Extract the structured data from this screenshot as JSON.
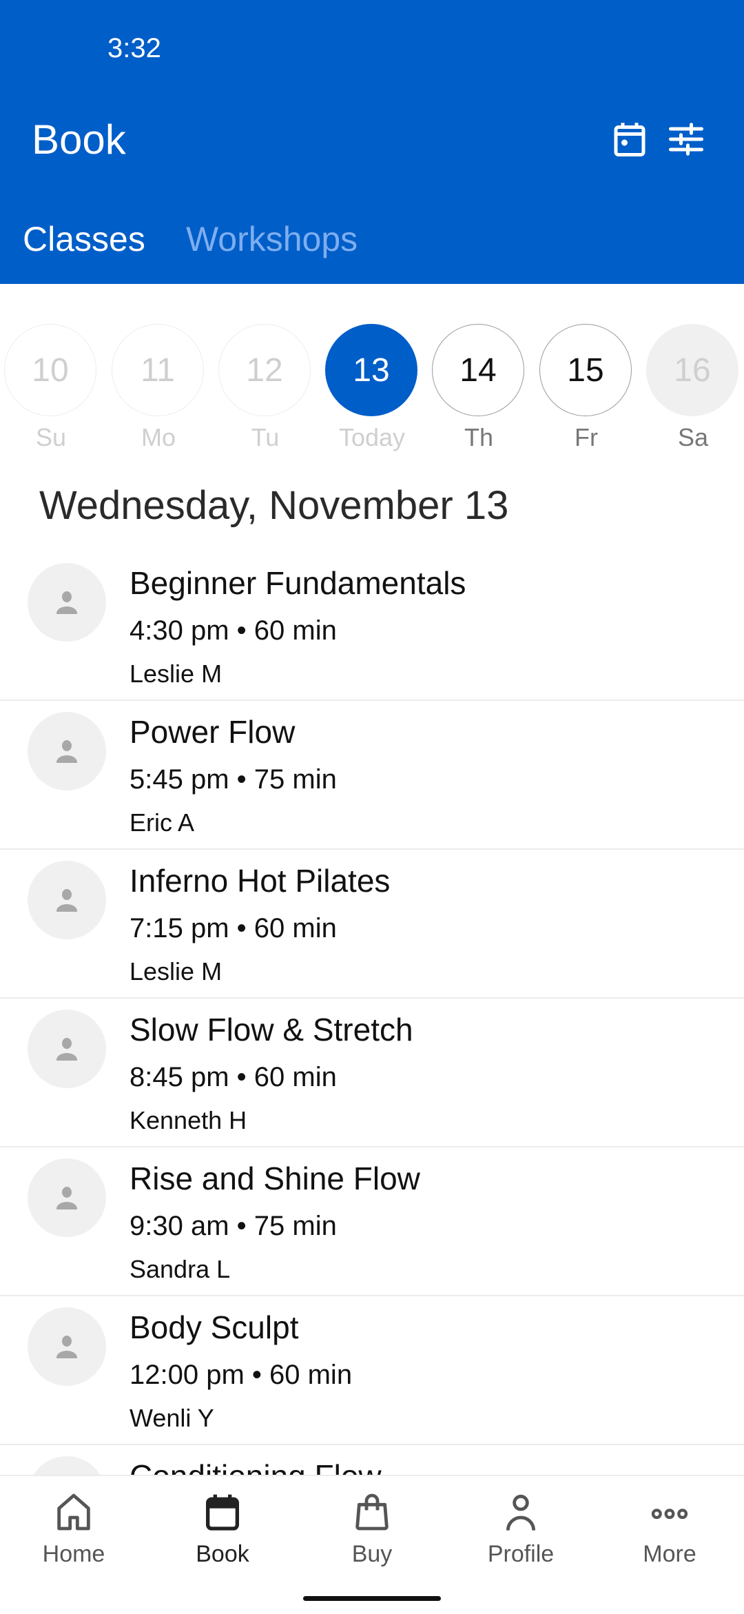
{
  "status_bar": {
    "time": "3:32"
  },
  "header": {
    "title": "Book",
    "icons": [
      "calendar-icon",
      "filter-sliders-icon"
    ],
    "tabs": [
      {
        "label": "Classes",
        "active": true
      },
      {
        "label": "Workshops",
        "active": false
      }
    ]
  },
  "colors": {
    "brand": "#005ec8",
    "tab_inactive": "#7eaef0",
    "avatar_bg": "#f0f0f0"
  },
  "date_strip": [
    {
      "number": "10",
      "label": "Su",
      "state": "past"
    },
    {
      "number": "11",
      "label": "Mo",
      "state": "past"
    },
    {
      "number": "12",
      "label": "Tu",
      "state": "past"
    },
    {
      "number": "13",
      "label": "Today",
      "state": "selected"
    },
    {
      "number": "14",
      "label": "Th",
      "state": "available"
    },
    {
      "number": "15",
      "label": "Fr",
      "state": "available"
    },
    {
      "number": "16",
      "label": "Sa",
      "state": "unavailable"
    }
  ],
  "day_heading": "Wednesday, November 13",
  "classes": [
    {
      "name": "Beginner Fundamentals",
      "time": "4:30 pm • 60 min",
      "instructor": "Leslie M"
    },
    {
      "name": "Power Flow",
      "time": "5:45 pm • 75 min",
      "instructor": "Eric A"
    },
    {
      "name": "Inferno Hot Pilates",
      "time": "7:15 pm • 60 min",
      "instructor": "Leslie M"
    },
    {
      "name": "Slow Flow & Stretch",
      "time": "8:45 pm • 60 min",
      "instructor": "Kenneth H"
    },
    {
      "name": "Rise and Shine Flow",
      "time": "9:30 am • 75 min",
      "instructor": "Sandra L"
    },
    {
      "name": "Body Sculpt",
      "time": "12:00 pm • 60 min",
      "instructor": "Wenli Y"
    },
    {
      "name": "Conditioning Flow",
      "time": "",
      "instructor": ""
    }
  ],
  "bottom_nav": [
    {
      "label": "Home",
      "icon": "home-icon",
      "active": false
    },
    {
      "label": "Book",
      "icon": "calendar-icon",
      "active": true
    },
    {
      "label": "Buy",
      "icon": "shopping-bag-icon",
      "active": false
    },
    {
      "label": "Profile",
      "icon": "person-icon",
      "active": false
    },
    {
      "label": "More",
      "icon": "more-dots-icon",
      "active": false
    }
  ]
}
